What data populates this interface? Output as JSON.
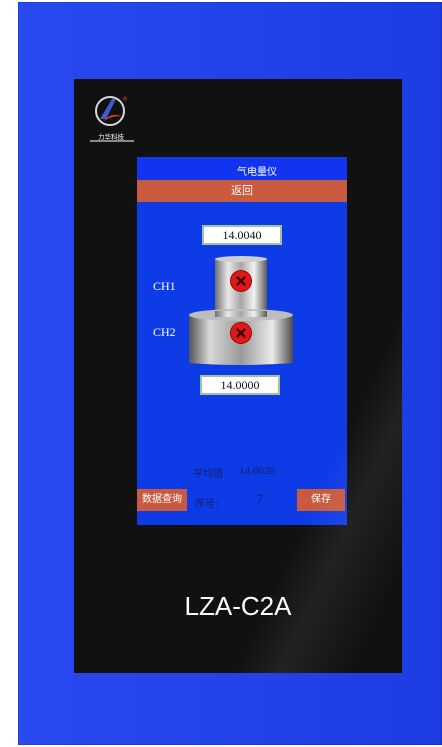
{
  "device": {
    "model": "LZA-C2A",
    "brand_logo_text": "力华科技",
    "housing_color": "#1f3ff0",
    "bezel_color": "#111111"
  },
  "screen": {
    "title": "气电量仪",
    "back_label": "返回",
    "ch1": {
      "label": "CH1",
      "value": "14.0040",
      "status_icon": "error-x-icon"
    },
    "ch2": {
      "label": "CH2",
      "value": "14.0000",
      "status_icon": "error-x-icon"
    },
    "average": {
      "label": "平均值",
      "value": "14.0020"
    },
    "sequence": {
      "label": "序号:",
      "value": "7"
    },
    "buttons": {
      "data_query": "数据查询",
      "save": "保存"
    },
    "colors": {
      "background": "#0d3be6",
      "button": "#c75a3f",
      "status_error": "#e01818"
    }
  }
}
